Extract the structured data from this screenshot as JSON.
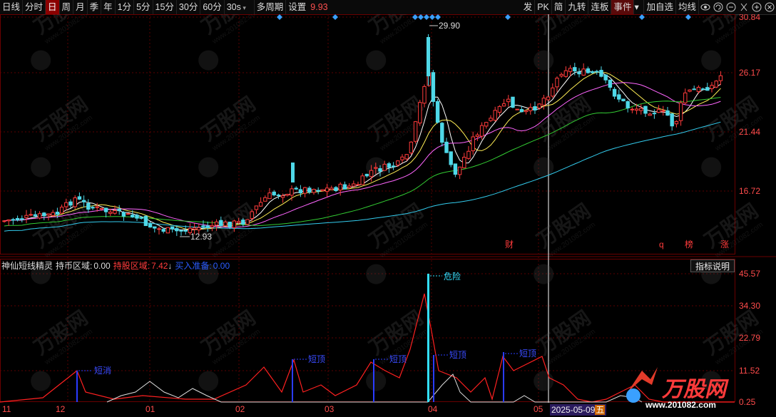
{
  "toolbar": {
    "items": [
      "日线",
      "分时",
      "日",
      "周",
      "月",
      "季",
      "年",
      "1分",
      "5分",
      "15分",
      "30分",
      "60分",
      "30s",
      "多周期",
      "设置"
    ],
    "price_fragment": "9.93",
    "right_items": [
      "发",
      "PK",
      "简",
      "九转",
      "连板",
      "事件",
      "加自选",
      "均线"
    ],
    "active_period": "日"
  },
  "main_axis": {
    "labels": [
      "30.84",
      "26.17",
      "21.44",
      "16.72"
    ]
  },
  "main_annotations": {
    "high_label": "29.90",
    "low_label": "12.93"
  },
  "event_markers": [
    "财",
    "q",
    "榜",
    "涨"
  ],
  "indicator": {
    "name": "神仙短线精灵",
    "hold_coin_label": "持币区域:",
    "hold_coin_value": "0.00",
    "hold_stock_label": "持股区域:",
    "hold_stock_value": "7.42",
    "arrow": "↓",
    "buy_label": "买入准备:",
    "buy_value": "0.00",
    "button": "指标说明",
    "axis_labels": [
      "45.57",
      "34.30",
      "22.79",
      "11.52",
      "0.25"
    ],
    "signals": [
      "短消",
      "短顶",
      "短顶",
      "短顶",
      "短顶"
    ],
    "danger": "危险"
  },
  "time_axis": {
    "labels": [
      "11",
      "12",
      "01",
      "02",
      "03",
      "04",
      "05"
    ]
  },
  "cursor_date": {
    "date": "2025-05-09",
    "weekday": "五"
  },
  "watermark": {
    "brand": "万股网",
    "url": "www.201082.com"
  },
  "colors": {
    "up": "#ff3b3b",
    "down": "#4fd8e8",
    "bg": "#000000",
    "grid": "#5a0000"
  }
}
